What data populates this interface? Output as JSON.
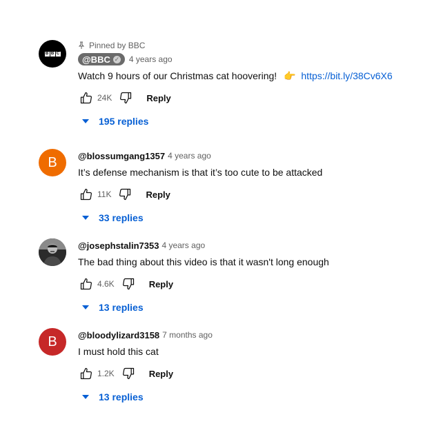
{
  "comments": [
    {
      "pinned": "Pinned by BBC",
      "author": "@BBC",
      "time": "4 years ago",
      "text": "Watch 9 hours of our Christmas cat hoovering!",
      "emoji": "👉",
      "link": "https://bit.ly/38Cv6X6",
      "likes": "24K",
      "reply_label": "Reply",
      "replies_label": "195 replies",
      "avatar_text": "BBC"
    },
    {
      "author": "@blossumgang1357",
      "time": "4 years ago",
      "text": "It’s defense mechanism is that it’s too cute to be attacked",
      "likes": "11K",
      "reply_label": "Reply",
      "replies_label": "33 replies",
      "avatar_letter": "B",
      "avatar_color": "#ef6c00"
    },
    {
      "author": "@josephstalin7353",
      "time": "4 years ago",
      "text": "The bad thing about this video is that it wasn't long enough",
      "likes": "4.6K",
      "reply_label": "Reply",
      "replies_label": "13 replies"
    },
    {
      "author": "@bloodylizard3158",
      "time": "7 months ago",
      "text": "I must hold this cat",
      "likes": "1.2K",
      "reply_label": "Reply",
      "replies_label": "13 replies",
      "avatar_letter": "B",
      "avatar_color": "#c62828"
    }
  ]
}
